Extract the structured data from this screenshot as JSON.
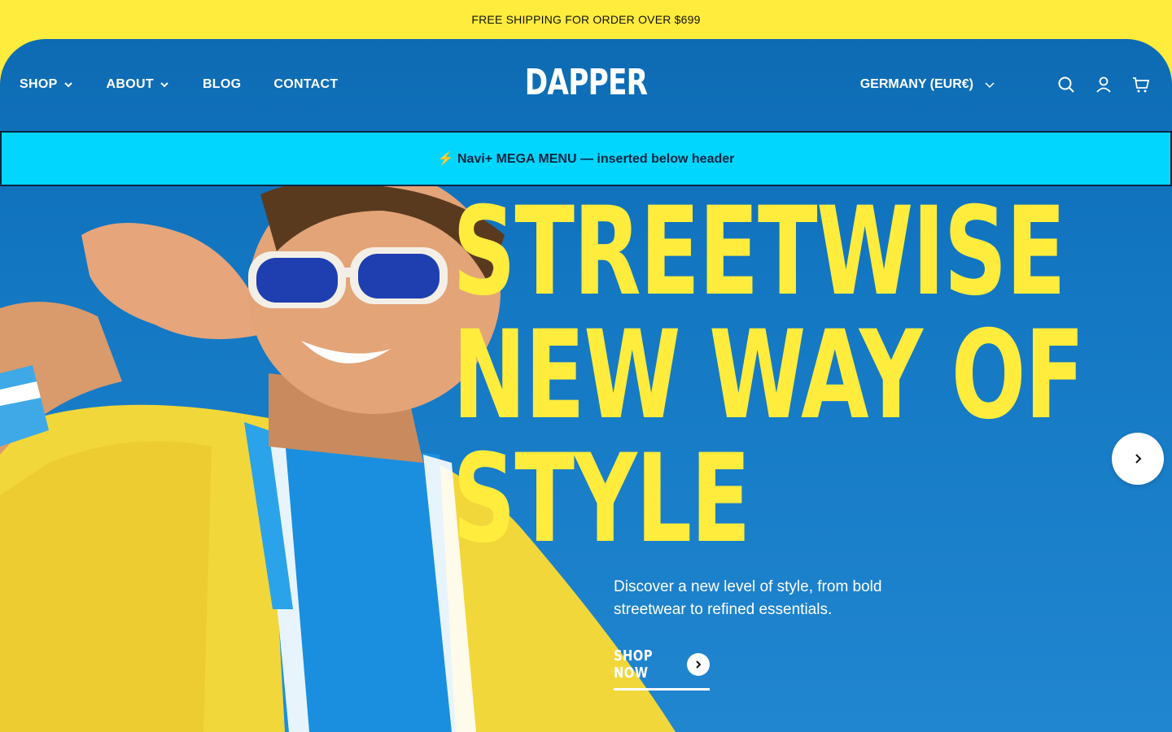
{
  "announcement": {
    "text": "FREE SHIPPING FOR ORDER OVER $699"
  },
  "header": {
    "nav": [
      {
        "label": "SHOP",
        "has_dropdown": true
      },
      {
        "label": "ABOUT",
        "has_dropdown": true
      },
      {
        "label": "BLOG",
        "has_dropdown": false
      },
      {
        "label": "CONTACT",
        "has_dropdown": false
      }
    ],
    "logo": "DAPPER",
    "locale": "GERMANY (EUR€)",
    "icons": [
      "search-icon",
      "account-icon",
      "cart-icon"
    ]
  },
  "mega_menu": {
    "text": "⚡ Navi+ MEGA MENU — inserted below header"
  },
  "hero": {
    "headline_lines": [
      "STREETWISE",
      "NEW WAY OF",
      "STYLE"
    ],
    "subtitle": "Discover a new level of style, from bold streetwear to refined essentials.",
    "cta_label": "SHOP NOW",
    "next_icon": "chevron-right-icon"
  },
  "colors": {
    "brand_yellow": "#ffec3d",
    "brand_blue": "#1377c2",
    "mega_cyan": "#00d6ff"
  }
}
